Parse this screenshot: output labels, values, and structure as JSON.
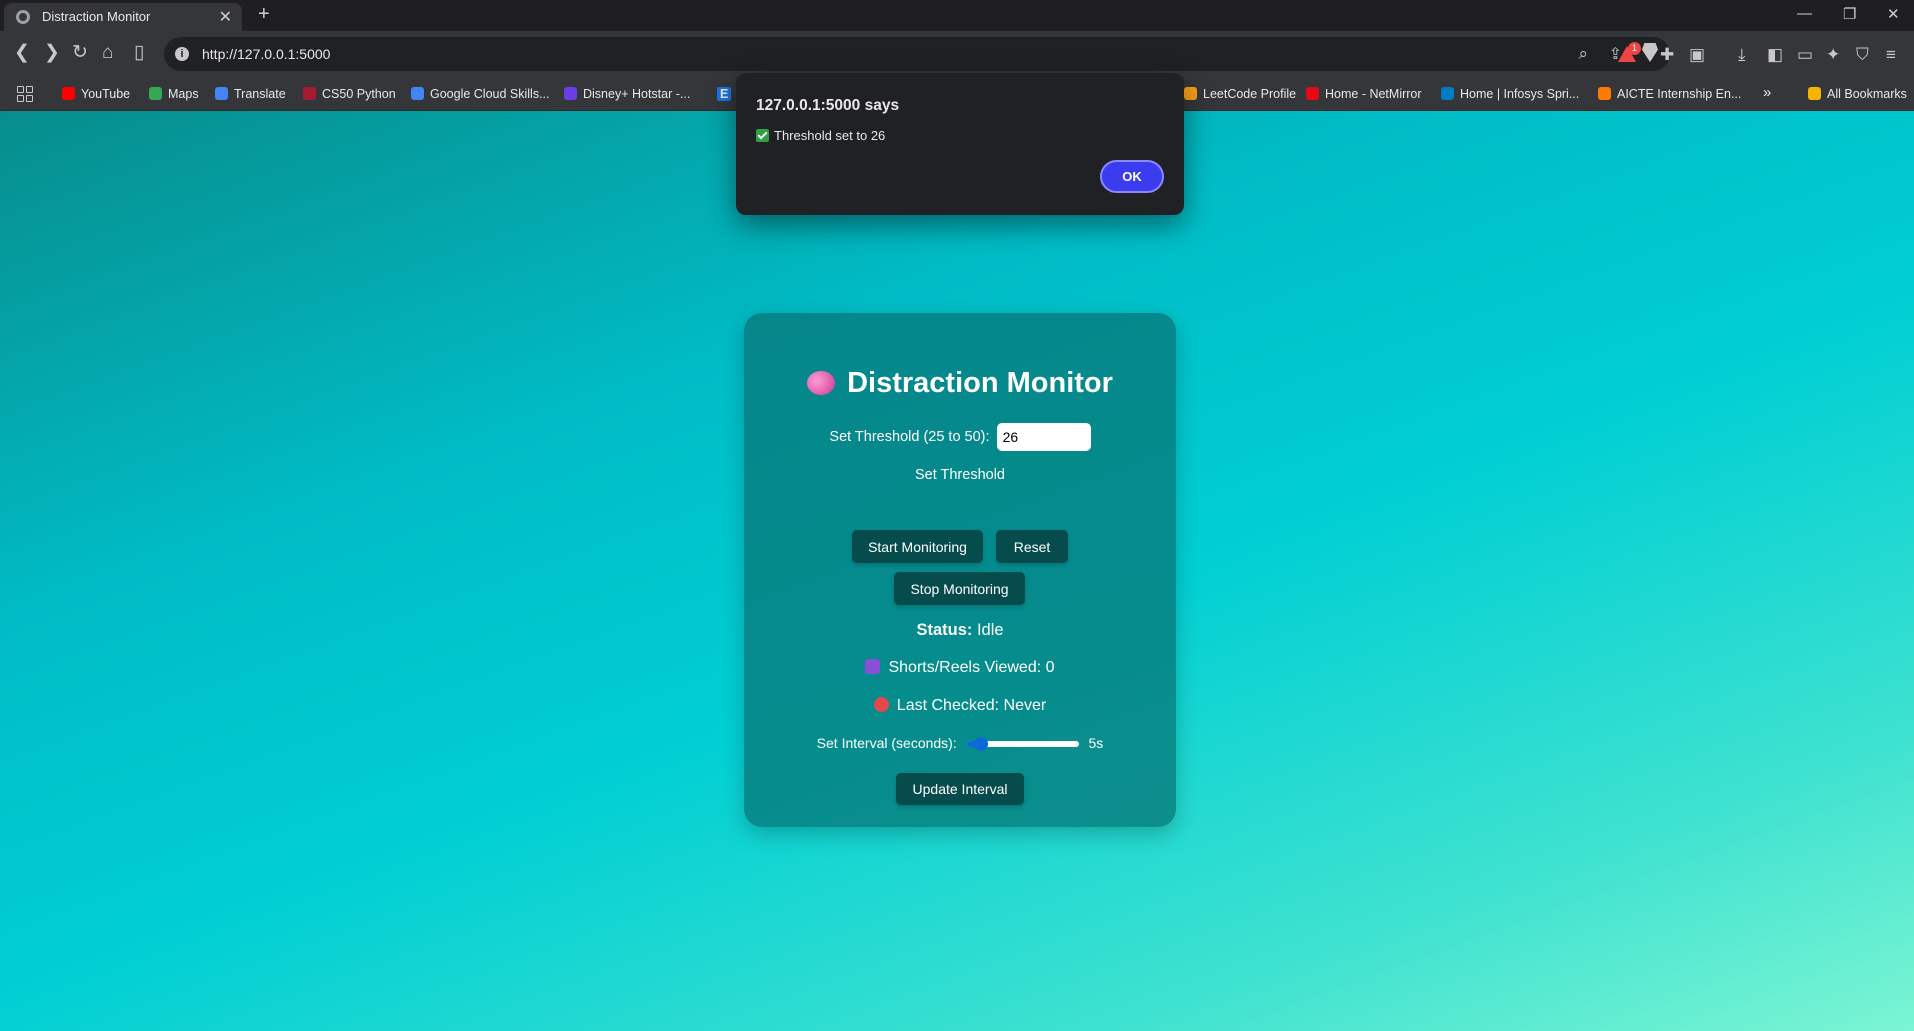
{
  "browser": {
    "tab_title": "Distraction Monitor",
    "tab_close": "✕",
    "new_tab": "+",
    "url": "http://127.0.0.1:5000",
    "window_controls": [
      "—",
      "❐",
      "✕"
    ]
  },
  "bookmarks": [
    {
      "label": "YouTube",
      "color": "#ff0000"
    },
    {
      "label": "Maps",
      "color": "#34a853"
    },
    {
      "label": "Translate",
      "color": "#4285f4"
    },
    {
      "label": "CS50 Python",
      "color": "#a51c30"
    },
    {
      "label": "Google Cloud Skills...",
      "color": "#4285f4"
    },
    {
      "label": "Disney+ Hotstar -...",
      "color": "#6a3de8"
    },
    {
      "label": "E",
      "color": "#1a73e8"
    },
    {
      "label": "LeetCode Profile",
      "color": "#f89f1b"
    },
    {
      "label": "Home - NetMirror",
      "color": "#e50914"
    },
    {
      "label": "Home | Infosys Spri...",
      "color": "#007cc3"
    },
    {
      "label": "AICTE Internship En...",
      "color": "#ff7a00"
    },
    {
      "label": "»",
      "color": ""
    },
    {
      "label": "All Bookmarks",
      "color": "#f4b400"
    }
  ],
  "dialog": {
    "title": "127.0.0.1:5000 says",
    "message": "Threshold set to 26",
    "ok_label": "OK"
  },
  "app": {
    "title": "Distraction Monitor",
    "threshold_label": "Set Threshold (25 to 50):",
    "threshold_value": "26",
    "set_threshold_label": "Set Threshold",
    "start_label": "Start Monitoring",
    "reset_label": "Reset",
    "stop_label": "Stop Monitoring",
    "status_label": "Status:",
    "status_value": "Idle",
    "shorts_text": "Shorts/Reels Viewed: 0",
    "last_checked_text": "Last Checked: Never",
    "interval_label": "Set Interval (seconds):",
    "interval_value": 5,
    "interval_min": 1,
    "interval_max": 60,
    "interval_display": "5s",
    "update_interval_label": "Update Interval"
  }
}
